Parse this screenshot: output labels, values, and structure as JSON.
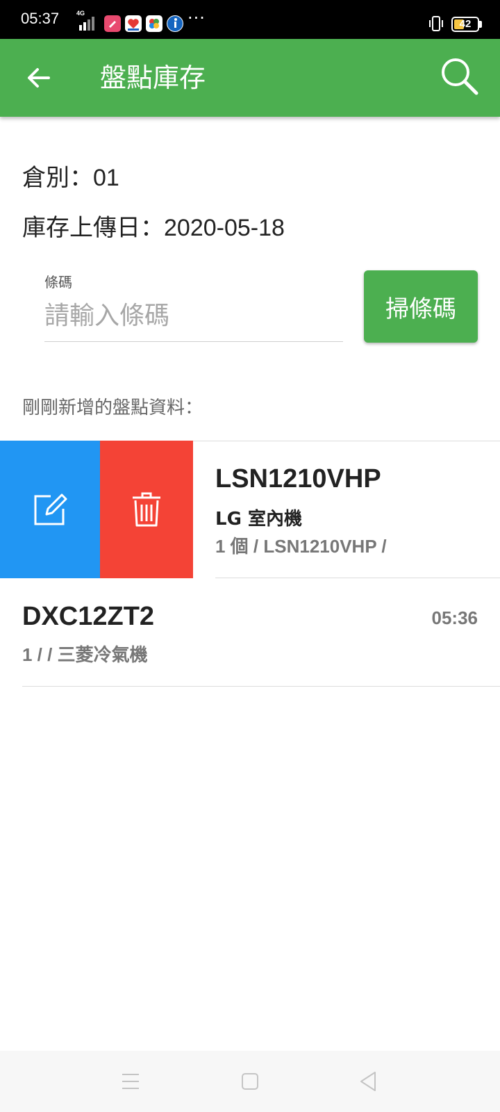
{
  "status_bar": {
    "time": "05:37",
    "network": "4G",
    "battery": "42",
    "more": "···",
    "icons": [
      "signal-icon",
      "app-pink-icon",
      "app-heart-icon",
      "app-colorful-icon",
      "app-blue-icon",
      "vibrate-icon",
      "battery-icon"
    ]
  },
  "app_bar": {
    "title": "盤點庫存",
    "back_icon": "arrow-left-icon",
    "search_icon": "search-icon",
    "color": "#4caf50"
  },
  "info": {
    "warehouse": "倉別：01",
    "upload_date": "庫存上傳日：2020-05-18"
  },
  "barcode": {
    "label": "條碼",
    "placeholder": "請輸入條碼",
    "value": "",
    "scan_button": "掃條碼"
  },
  "section_title": "剛剛新增的盤點資料：",
  "items": [
    {
      "code": "LSN1210VHP",
      "name": "LG 室內機",
      "detail": "1 個 / LSN1210VHP /",
      "actions": {
        "edit_icon": "edit-icon",
        "edit_color": "#2196f3",
        "delete_icon": "trash-icon",
        "delete_color": "#f44336"
      }
    },
    {
      "code": "DXC12ZT2",
      "time": "05:36",
      "detail": "1 / / 三菱冷氣機"
    }
  ],
  "nav_bar": {
    "icons": [
      "menu-icon",
      "home-square-icon",
      "back-triangle-icon"
    ]
  }
}
